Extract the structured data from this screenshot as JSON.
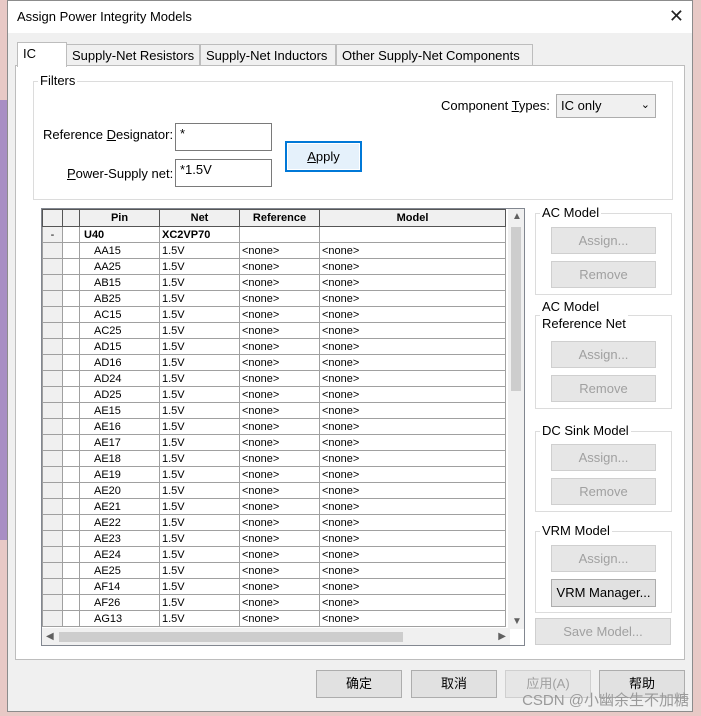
{
  "window": {
    "title": "Assign Power Integrity Models"
  },
  "tabs": [
    {
      "label": "IC",
      "active": true
    },
    {
      "label": "Supply-Net Resistors"
    },
    {
      "label": "Supply-Net Inductors"
    },
    {
      "label": "Other Supply-Net Components"
    }
  ],
  "filters": {
    "group_label": "Filters",
    "component_types_label": "Component Types:",
    "component_types_access": "T",
    "component_types_pre": "Component ",
    "component_types_post": "ypes:",
    "component_types_value": "IC only",
    "ref_des_pre": "Reference ",
    "ref_des_access": "D",
    "ref_des_post": "esignator:",
    "ref_des_value": "*",
    "power_net_access": "P",
    "power_net_post": "ower-Supply net:",
    "power_net_value": "*1.5V",
    "apply_access": "A",
    "apply_post": "pply"
  },
  "grid": {
    "columns": [
      "Pin",
      "Net",
      "Reference",
      "Model"
    ],
    "component": {
      "toggle": "-",
      "pin": "U40",
      "net": "XC2VP70"
    },
    "rows": [
      [
        "AA15",
        "1.5V",
        "<none>",
        "<none>"
      ],
      [
        "AA25",
        "1.5V",
        "<none>",
        "<none>"
      ],
      [
        "AB15",
        "1.5V",
        "<none>",
        "<none>"
      ],
      [
        "AB25",
        "1.5V",
        "<none>",
        "<none>"
      ],
      [
        "AC15",
        "1.5V",
        "<none>",
        "<none>"
      ],
      [
        "AC25",
        "1.5V",
        "<none>",
        "<none>"
      ],
      [
        "AD15",
        "1.5V",
        "<none>",
        "<none>"
      ],
      [
        "AD16",
        "1.5V",
        "<none>",
        "<none>"
      ],
      [
        "AD24",
        "1.5V",
        "<none>",
        "<none>"
      ],
      [
        "AD25",
        "1.5V",
        "<none>",
        "<none>"
      ],
      [
        "AE15",
        "1.5V",
        "<none>",
        "<none>"
      ],
      [
        "AE16",
        "1.5V",
        "<none>",
        "<none>"
      ],
      [
        "AE17",
        "1.5V",
        "<none>",
        "<none>"
      ],
      [
        "AE18",
        "1.5V",
        "<none>",
        "<none>"
      ],
      [
        "AE19",
        "1.5V",
        "<none>",
        "<none>"
      ],
      [
        "AE20",
        "1.5V",
        "<none>",
        "<none>"
      ],
      [
        "AE21",
        "1.5V",
        "<none>",
        "<none>"
      ],
      [
        "AE22",
        "1.5V",
        "<none>",
        "<none>"
      ],
      [
        "AE23",
        "1.5V",
        "<none>",
        "<none>"
      ],
      [
        "AE24",
        "1.5V",
        "<none>",
        "<none>"
      ],
      [
        "AE25",
        "1.5V",
        "<none>",
        "<none>"
      ],
      [
        "AF14",
        "1.5V",
        "<none>",
        "<none>"
      ],
      [
        "AF26",
        "1.5V",
        "<none>",
        "<none>"
      ],
      [
        "AG13",
        "1.5V",
        "<none>",
        "<none>"
      ]
    ]
  },
  "side": {
    "ac_model": {
      "label": "AC Model",
      "assign": "Assign...",
      "remove": "Remove"
    },
    "ac_ref_net": {
      "label_line1": "AC Model",
      "label_line2": "Reference Net",
      "assign": "Assign...",
      "remove": "Remove"
    },
    "dc_sink": {
      "label": "DC Sink Model",
      "assign": "Assign...",
      "remove": "Remove"
    },
    "vrm": {
      "label": "VRM Model",
      "assign": "Assign...",
      "manager": "VRM Manager..."
    },
    "save_model": "Save Model..."
  },
  "footer": {
    "ok": "确定",
    "cancel": "取消",
    "apply": "应用(A)",
    "help": "帮助"
  },
  "watermark": "CSDN @小幽余生不加糖"
}
